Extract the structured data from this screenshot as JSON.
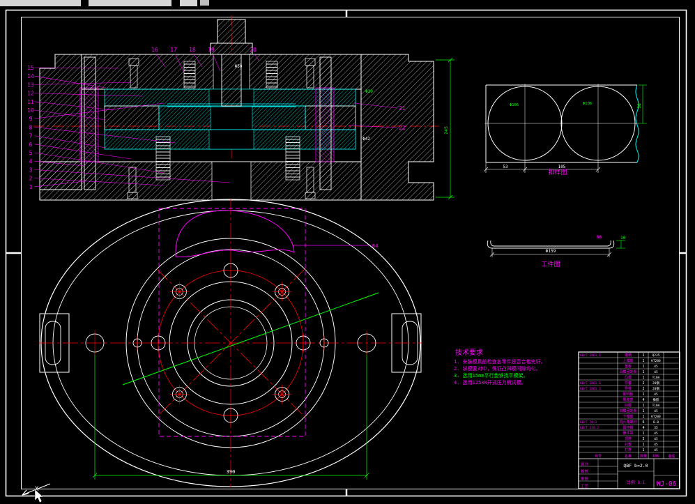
{
  "colors": {
    "bg": "#000000",
    "line": "#ffffff",
    "magenta": "#ff00ff",
    "cyan": "#00ffff",
    "red": "#ff0000",
    "green": "#00ff00"
  },
  "section_view": {
    "left_labels": [
      "15",
      "14",
      "13",
      "12",
      "11",
      "10",
      "9",
      "8",
      "7",
      "6",
      "5",
      "4",
      "3",
      "2",
      "1"
    ],
    "top_labels": [
      "16",
      "17",
      "18",
      "19",
      "20"
    ],
    "right_labels": [
      "21",
      "22"
    ],
    "dim_height": "245",
    "dim_punch": "Φ50",
    "dim_a": "Φ30",
    "dim_b": "Φ42"
  },
  "strip_view": {
    "label": "排样图",
    "dim_edge": "53",
    "dim_pitch": "105",
    "dim_width": "56",
    "circle_label": "Φ106",
    "circle_label2": "Φ106"
  },
  "workpiece_view": {
    "label": "工件图",
    "dim_h": "10",
    "dim_r": "R6",
    "dim_d": "Φ159"
  },
  "plan_view": {
    "dim_span": "390",
    "leader_label": "R4"
  },
  "tech_notes": {
    "title": "技术要求",
    "lines": [
      {
        "text": "1. 安装模具前检查各零件是否合格完好。",
        "color": "#ff00ff"
      },
      {
        "text": "2. 装模要对中，保证凸凹模间隙均匀。",
        "color": "#ff00ff"
      },
      {
        "text": "3. 选用15mm平行垫铁找平模架。",
        "color": "#00ff00"
      },
      {
        "text": "4. 选用125kN开式压力机试模。",
        "color": "#ff00ff"
      }
    ]
  },
  "title_block": {
    "drawing_no": "WJ-06",
    "spec": "QBF  b=2.0",
    "scale_label": "比例 1:1",
    "sign_labels": [
      "设计",
      "校核",
      "审核",
      "工艺"
    ],
    "header": [
      "代号",
      "名称",
      "数量",
      "材料",
      "备注"
    ],
    "rows": [
      [
        "GB/T 2861.1",
        "模柄",
        "1",
        "Q235",
        ""
      ],
      [
        "",
        "上模座",
        "1",
        "HT200",
        ""
      ],
      [
        "",
        "垫板",
        "1",
        "45",
        ""
      ],
      [
        "",
        "凸模固定板",
        "1",
        "45",
        ""
      ],
      [
        "",
        "凸模",
        "1",
        "T10A",
        ""
      ],
      [
        "GB/T 2861.6",
        "导套",
        "2",
        "20钢",
        ""
      ],
      [
        "GB/T 2861.3",
        "导柱",
        "2",
        "20钢",
        ""
      ],
      [
        "",
        "卸料板",
        "1",
        "45",
        ""
      ],
      [
        "",
        "橡胶垫",
        "4",
        "橡胶",
        ""
      ],
      [
        "",
        "凹模",
        "1",
        "T10A",
        ""
      ],
      [
        "",
        "凹模固定板",
        "1",
        "45",
        ""
      ],
      [
        "",
        "下模座",
        "1",
        "HT200",
        ""
      ],
      [
        "GB/T 70.1",
        "内六角螺钉",
        "6",
        "8.8",
        ""
      ],
      [
        "GB/T 119.2",
        "圆柱销",
        "4",
        "35",
        ""
      ],
      [
        "",
        "推件块",
        "1",
        "45",
        ""
      ],
      [
        "",
        "顶杆",
        "3",
        "45",
        ""
      ],
      [
        "",
        "托板",
        "1",
        "45",
        ""
      ],
      [
        "",
        "打杆",
        "1",
        "45",
        ""
      ]
    ]
  },
  "ucs": {
    "x_label": "X"
  }
}
